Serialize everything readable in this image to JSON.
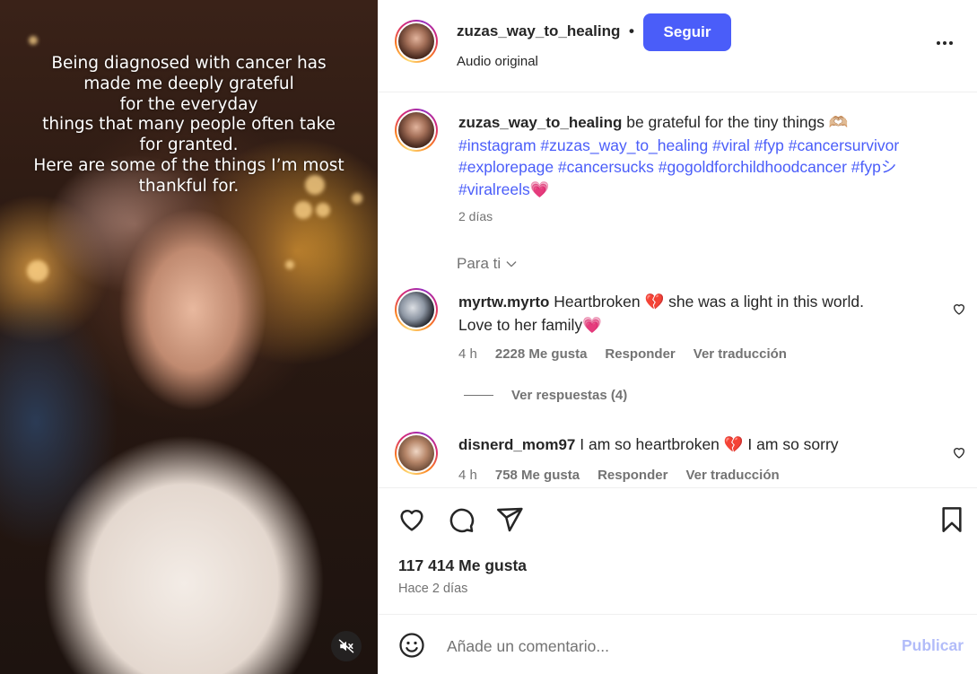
{
  "media": {
    "caption_lines": [
      "Being diagnosed with cancer has",
      "made me deeply grateful",
      "for the everyday",
      "things that many people often take",
      "for granted.",
      "Here are some of the things I’m most",
      "thankful for."
    ],
    "mute_icon": "speaker-muted-icon"
  },
  "header": {
    "username": "zuzas_way_to_healing",
    "dot": "•",
    "follow_label": "Seguir",
    "subtitle": "Audio original",
    "more_icon": "more-dots-icon"
  },
  "caption": {
    "username": "zuzas_way_to_healing",
    "text": "be grateful for the tiny things 🫶🏼",
    "hashtags_line1": "#instagram #zuzas_way_to_healing #viral #fyp #cancersurvivor",
    "hashtags_line2": "#explorepage #cancersucks #gogoldforchildhoodcancer #fypシ",
    "hashtags_line3": "#viralreels",
    "hashtags_line3_emoji": "💗",
    "time": "2 días"
  },
  "for_you": {
    "label": "Para ti",
    "icon": "chevron-down-icon"
  },
  "comments": [
    {
      "username": "myrtw.myrto",
      "text": "Heartbroken 💔 she was a light in this world.",
      "text_line2": "Love to her family💗",
      "time": "4 h",
      "likes": "2228 Me gusta",
      "reply": "Responder",
      "translate": "Ver traducción"
    },
    {
      "username": "disnerd_mom97",
      "text": "I am so heartbroken 💔  I am so sorry",
      "time": "4 h",
      "likes": "758 Me gusta",
      "reply": "Responder",
      "translate": "Ver traducción"
    }
  ],
  "replies": {
    "label": "Ver respuestas (4)"
  },
  "actions": {
    "like_icon": "heart-icon",
    "comment_icon": "comment-icon",
    "share_icon": "share-icon",
    "save_icon": "bookmark-icon"
  },
  "stats": {
    "likes": "117 414 Me gusta",
    "posted": "Hace 2 días"
  },
  "comment_box": {
    "placeholder": "Añade un comentario...",
    "publish_label": "Publicar",
    "emoji_icon": "emoji-icon"
  },
  "colors": {
    "accent": "#4a5df9",
    "muted": "#737373",
    "publish_disabled": "#b2bcf9",
    "text": "#262626"
  }
}
